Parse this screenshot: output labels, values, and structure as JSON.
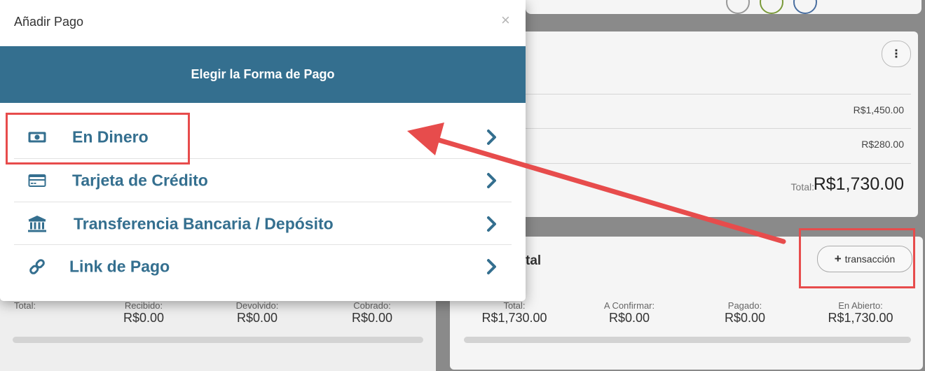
{
  "modal": {
    "title": "Añadir Pago",
    "close_label": "×",
    "band_title": "Elegir la Forma de Pago",
    "options": [
      {
        "label": "En Dinero",
        "icon": "cash-icon"
      },
      {
        "label": "Tarjeta de Crédito",
        "icon": "credit-card-icon"
      },
      {
        "label": "Transferencia Bancaria / Depósito",
        "icon": "bank-icon"
      },
      {
        "label": "Link de Pago",
        "icon": "link-icon"
      }
    ]
  },
  "summary": {
    "menu_label": "⋮",
    "amounts": [
      "R$1,450.00",
      "R$280.00"
    ],
    "total_label": "Total:",
    "total_value": "R$1,730.00"
  },
  "transactions": {
    "title_fragment": "tal",
    "add_button_label": "transacción",
    "stats": [
      {
        "label": "Total:",
        "value": "R$1,730.00"
      },
      {
        "label": "A Confirmar:",
        "value": "R$0.00"
      },
      {
        "label": "Pagado:",
        "value": "R$0.00"
      },
      {
        "label": "En Abierto:",
        "value": "R$1,730.00"
      }
    ]
  },
  "left_panel": {
    "stats": [
      {
        "label": "Total:",
        "value": ""
      },
      {
        "label": "Recibido:",
        "value": "R$0.00"
      },
      {
        "label": "Devolvido:",
        "value": "R$0.00"
      },
      {
        "label": "Cobrado:",
        "value": "R$0.00"
      }
    ]
  },
  "colors": {
    "accent": "#346f8f",
    "annotation": "#e74c4c",
    "overlay": "#8a8a8a"
  }
}
